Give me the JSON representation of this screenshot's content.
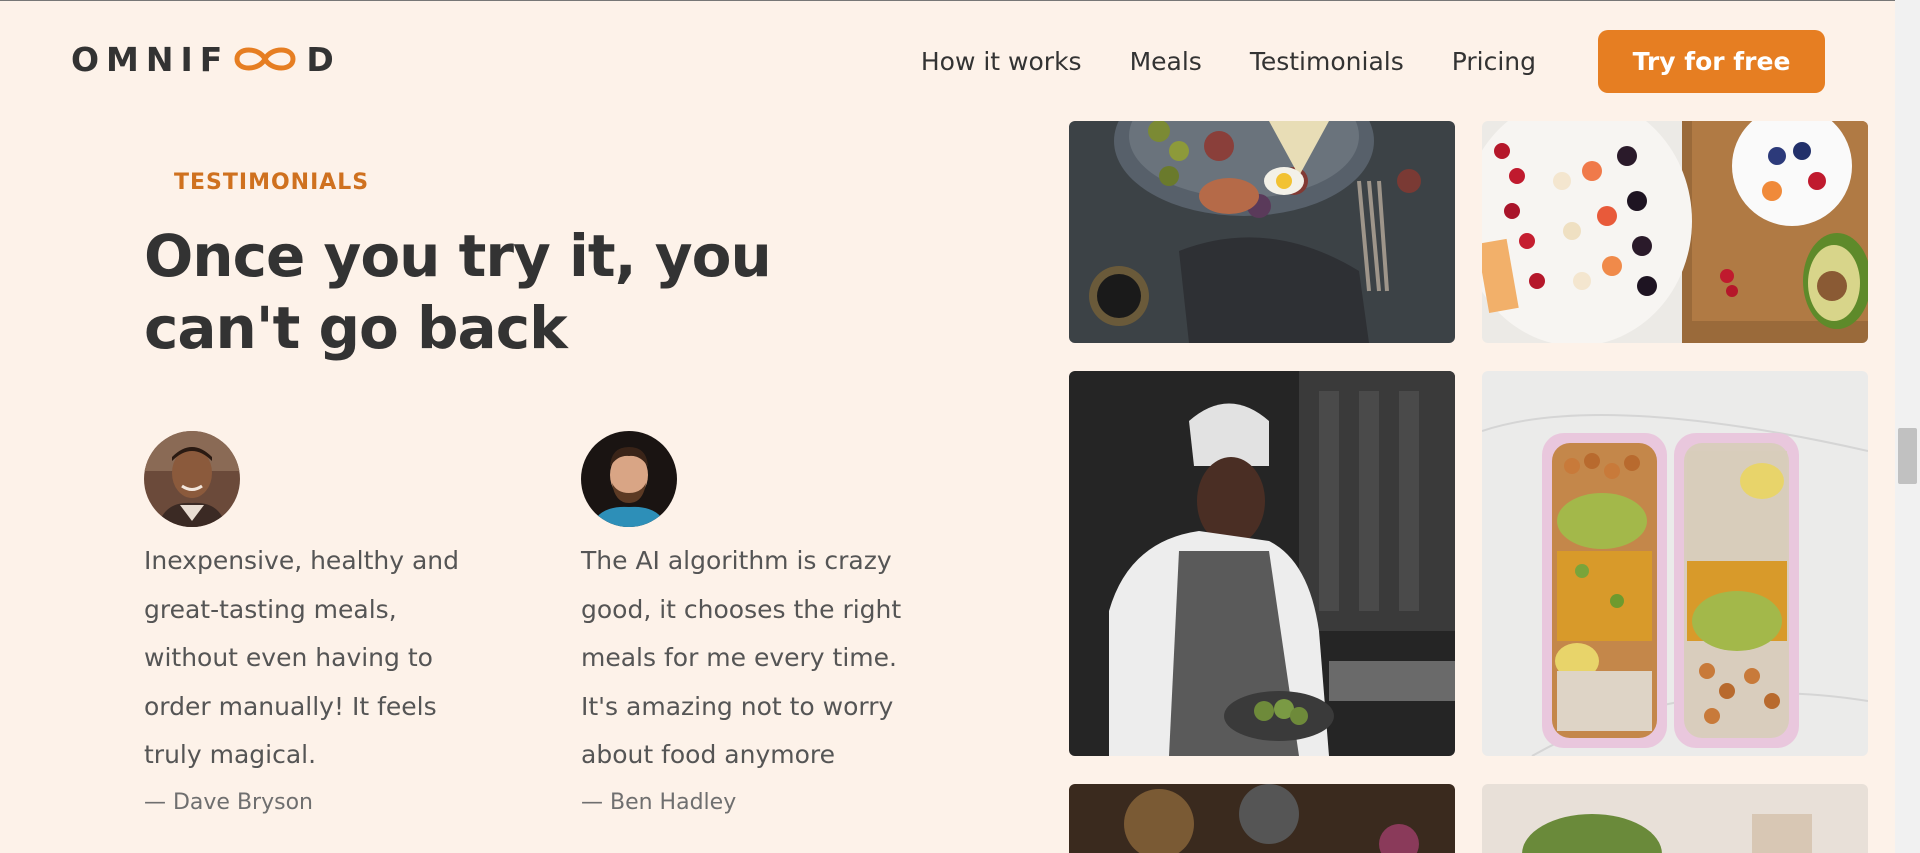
{
  "header": {
    "logo_text_left": "OMNIF",
    "logo_text_right": "D",
    "nav": [
      "How it works",
      "Meals",
      "Testimonials",
      "Pricing"
    ],
    "cta": "Try for free"
  },
  "section": {
    "subheading": "TESTIMONIALS",
    "heading": "Once you try it, you can't go back"
  },
  "testimonials": [
    {
      "quote": "Inexpensive, healthy and great-tasting meals, without even having to order manually! It feels truly magical.",
      "author": "— Dave Bryson"
    },
    {
      "quote": "The AI algorithm is crazy good, it chooses the right meals for me every time. It's amazing not to worry about food anymore",
      "author": "— Ben Hadley"
    }
  ],
  "colors": {
    "background": "#fdf2e9",
    "accent": "#e67e22",
    "heading": "#333333"
  }
}
